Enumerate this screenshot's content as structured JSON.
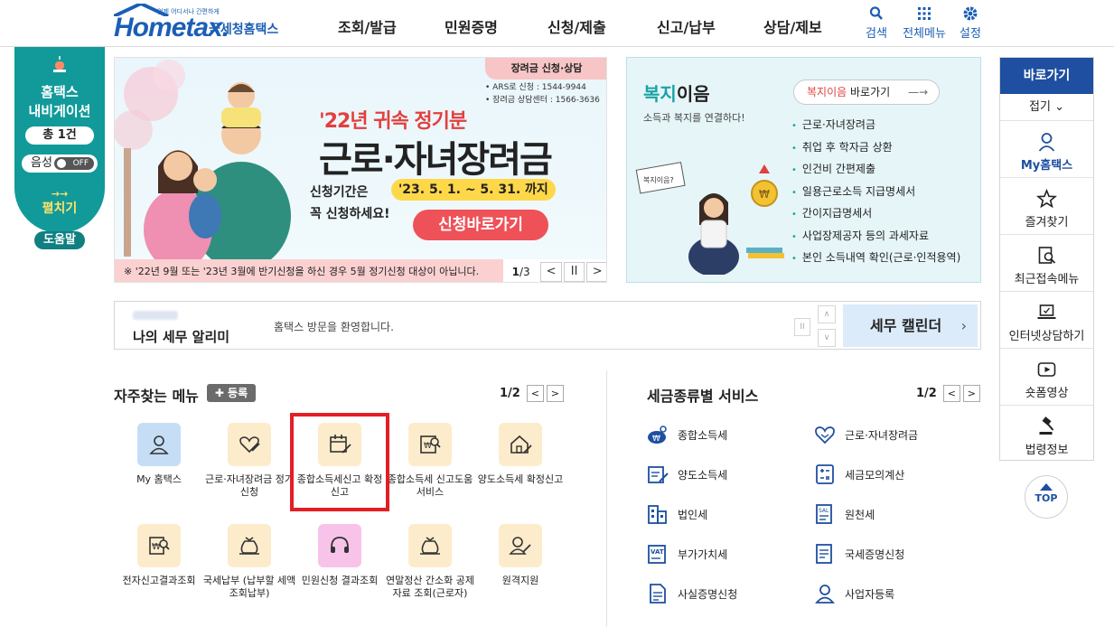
{
  "header": {
    "logo_tiny": "언제 어디서나 간편하게",
    "logo_word": "Hometax.",
    "logo_sub": "국세청홈택스",
    "nav": [
      "조회/발급",
      "민원증명",
      "신청/제출",
      "신고/납부",
      "상담/제보"
    ],
    "util": [
      {
        "label": "검색",
        "icon": "search-icon"
      },
      {
        "label": "전체메뉴",
        "icon": "grid-icon"
      },
      {
        "label": "설정",
        "icon": "gear-icon"
      }
    ]
  },
  "leftnav": {
    "title_line1": "홈택스",
    "title_line2": "내비게이션",
    "count": "총 1건",
    "voice_label": "음성",
    "voice_state": "OFF",
    "expand_arrow": "→→",
    "expand_label": "펼치기",
    "help_label": "도움말"
  },
  "banner": {
    "tag": "장려금 신청·상담",
    "ars_line1": "• ARS로 신청 : 1544-9944",
    "ars_line2": "• 장려금 상담센터 : 1566-3636",
    "kicker": "'22년 귀속 정기분",
    "headline": "근로·자녀장려금",
    "period_label": "신청기간은",
    "period": "'23. 5. 1. ~ 5. 31. 까지",
    "must": "꼭 신청하세요!",
    "apply_label": "신청바로가기",
    "notice": "※ '22년 9월 또는 '23년 3월에 반기신청을 하신 경우 5월 정기신청 대상이 아닙니다.",
    "page_current": "1",
    "page_total": "/3",
    "prev": "<",
    "pause": "II",
    "next": ">"
  },
  "welfare": {
    "title_hl": "복지",
    "title_rest": "이음",
    "subtitle": "소득과 복지를 연결하다!",
    "goto_hl": "복지이음",
    "goto_rest": " 바로가기",
    "goto_arrow": "—→",
    "items": [
      "근로·자녀장려금",
      "취업 후 학자금 상환",
      "인건비 간편제출",
      "일용근로소득 지급명세서",
      "간이지급명세서",
      "사업장제공자 등의 과세자료",
      "본인 소득내역 확인(근로·인적용역)"
    ],
    "illus_sign": "복지이음?"
  },
  "quick": {
    "title": "바로가기",
    "fold": "접기 ⌄",
    "items": [
      {
        "label": "My홈택스",
        "icon": "person-icon"
      },
      {
        "label": "즐겨찾기",
        "icon": "star-icon"
      },
      {
        "label": "최근접속메뉴",
        "icon": "recent-menu-icon"
      },
      {
        "label": "인터넷상담하기",
        "icon": "laptop-icon"
      },
      {
        "label": "숏폼영상",
        "icon": "play-icon"
      },
      {
        "label": "법령정보",
        "icon": "gavel-icon"
      }
    ],
    "top_label": "TOP"
  },
  "alert": {
    "title": "나의 세무 알리미",
    "message": "홈택스 방문을 환영합니다.",
    "calendar_label": "세무 캘린더",
    "calendar_arrow": "›",
    "pause": "II",
    "up": "∧",
    "down": "∨"
  },
  "favorites": {
    "title": "자주찾는 메뉴",
    "register_label": "✚ 등록",
    "page": "1/2",
    "prev": "<",
    "next": ">",
    "items": [
      {
        "label": "My 홈택스",
        "icon": "person-icon"
      },
      {
        "label": "근로·자녀장려금 정기신청",
        "icon": "heart-pen-icon"
      },
      {
        "label": "종합소득세신고 확정신고",
        "icon": "calendar-pen-icon"
      },
      {
        "label": "종합소득세 신고도움 서비스",
        "icon": "document-search-icon"
      },
      {
        "label": "양도소득세 확정신고",
        "icon": "house-pen-icon"
      },
      {
        "label": "전자신고결과조회",
        "icon": "won-search-icon"
      },
      {
        "label": "국세납부 (납부할 세액 조회납부)",
        "icon": "money-bag-icon"
      },
      {
        "label": "민원신청 결과조회",
        "icon": "headset-icon"
      },
      {
        "label": "연말정산 간소화 공제자료 조회(근로자)",
        "icon": "money-bag-icon"
      },
      {
        "label": "원격지원",
        "icon": "person-pen-icon"
      }
    ]
  },
  "taxservice": {
    "title": "세금종류별 서비스",
    "page": "1/2",
    "prev": "<",
    "next": ">",
    "items": [
      {
        "label": "종합소득세",
        "icon": "won-coins-icon"
      },
      {
        "label": "근로·자녀장려금",
        "icon": "heart-icon"
      },
      {
        "label": "양도소득세",
        "icon": "document-pen-icon"
      },
      {
        "label": "세금모의계산",
        "icon": "calculator-icon"
      },
      {
        "label": "법인세",
        "icon": "building-icon"
      },
      {
        "label": "원천세",
        "icon": "receipt-icon"
      },
      {
        "label": "부가가치세",
        "icon": "vat-icon"
      },
      {
        "label": "국세증명신청",
        "icon": "certificate-icon"
      },
      {
        "label": "사실증명신청",
        "icon": "document-icon"
      },
      {
        "label": "사업자등록",
        "icon": "person-icon"
      }
    ]
  },
  "colors": {
    "brand_blue": "#1b5fb5",
    "teal": "#129a9a",
    "highlight_red": "#e31e24",
    "apply_red": "#ee5157"
  }
}
